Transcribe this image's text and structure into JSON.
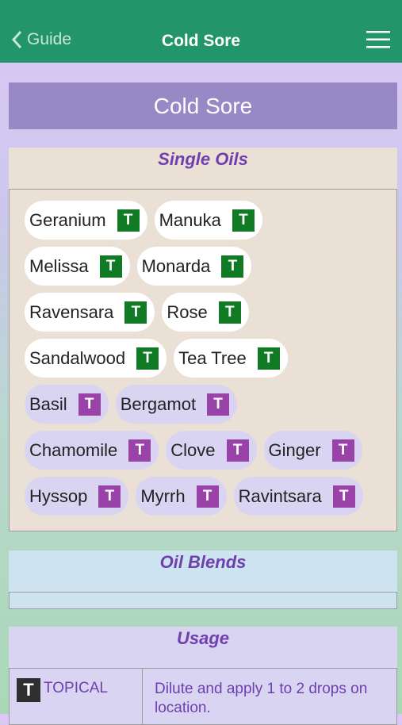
{
  "nav": {
    "back_label": "Guide",
    "title": "Cold Sore"
  },
  "hero": {
    "title": "Cold Sore"
  },
  "single_oils": {
    "header": "Single Oils",
    "rows": [
      [
        {
          "label": "Geranium",
          "badge": "T",
          "color": "#117a25"
        },
        {
          "label": "Manuka",
          "badge": "T",
          "color": "#117a25"
        }
      ],
      [
        {
          "label": "Melissa",
          "badge": "T",
          "color": "#117a25"
        },
        {
          "label": "Monarda",
          "badge": "T",
          "color": "#117a25"
        }
      ],
      [
        {
          "label": "Ravensara",
          "badge": "T",
          "color": "#117a25"
        },
        {
          "label": "Rose",
          "badge": "T",
          "color": "#117a25"
        }
      ],
      [
        {
          "label": "Sandalwood",
          "badge": "T",
          "color": "#117a25"
        },
        {
          "label": "Tea Tree",
          "badge": "T",
          "color": "#117a25"
        }
      ],
      [
        {
          "label": "Basil",
          "badge": "T",
          "color": "#9943a8"
        },
        {
          "label": "Bergamot",
          "badge": "T",
          "color": "#9943a8"
        }
      ],
      [
        {
          "label": "Chamomile",
          "badge": "T",
          "color": "#9943a8"
        },
        {
          "label": "Clove",
          "badge": "T",
          "color": "#9943a8"
        },
        {
          "label": "Ginger",
          "badge": "T",
          "color": "#9943a8"
        }
      ],
      [
        {
          "label": "Hyssop",
          "badge": "T",
          "color": "#9943a8"
        },
        {
          "label": "Myrrh",
          "badge": "T",
          "color": "#9943a8"
        },
        {
          "label": "Ravintsara",
          "badge": "T",
          "color": "#9943a8"
        }
      ]
    ]
  },
  "oil_blends": {
    "header": "Oil Blends"
  },
  "usage": {
    "header": "Usage",
    "badge": "T",
    "method": "TOPICAL",
    "instructions": "Dilute and apply 1 to 2 drops on location."
  }
}
